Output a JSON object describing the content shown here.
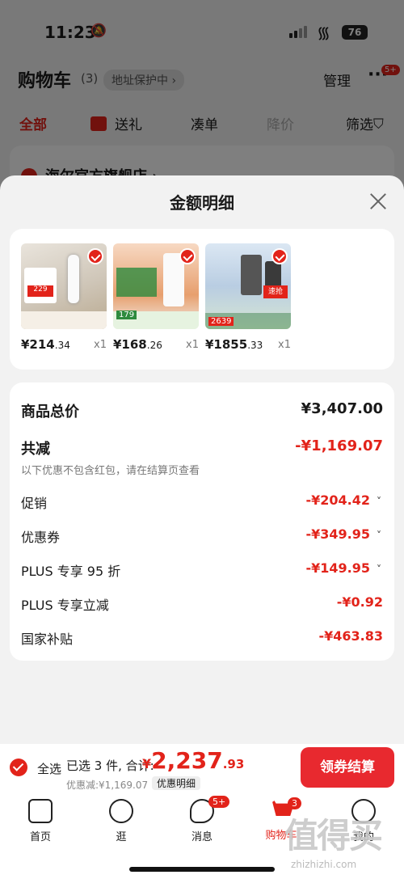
{
  "status_bar": {
    "time": "11:23",
    "battery": "76"
  },
  "header": {
    "title": "购物车",
    "count": "(3)",
    "address_protect": "地址保护中 ›",
    "manage": "管理",
    "more": "···",
    "more_badge": "5+"
  },
  "tabs": [
    "全部",
    "送礼",
    "凑单",
    "降价",
    "筛选"
  ],
  "store_name": "海尔官方旗舰店 ›",
  "sheet": {
    "title": "金额明细",
    "products": [
      {
        "price_main": "¥214",
        "price_dec": ".34",
        "qty": "x1"
      },
      {
        "price_main": "¥168",
        "price_dec": ".26",
        "qty": "x1"
      },
      {
        "price_main": "¥1855",
        "price_dec": ".33",
        "qty": "x1"
      }
    ],
    "product_images": {
      "p1_tag": "229",
      "p2_price": "179",
      "p3_hot": "速抢",
      "p3_price": "2639"
    },
    "total_label": "商品总价",
    "total_value": "¥3,407.00",
    "reduce_label": "共减",
    "reduce_value": "-¥1,169.07",
    "note": "以下优惠不包含红包，请在结算页查看",
    "items": [
      {
        "label": "促销",
        "value": "-¥204.42",
        "expand": "˅"
      },
      {
        "label": "优惠券",
        "value": "-¥349.95",
        "expand": "˅"
      },
      {
        "label": "PLUS 专享 95 折",
        "value": "-¥149.95",
        "expand": "˅"
      },
      {
        "label": "PLUS 专享立减",
        "value": "-¥0.92",
        "expand": ""
      },
      {
        "label": "国家补贴",
        "value": "-¥463.83",
        "expand": ""
      }
    ]
  },
  "bottom_bar": {
    "select_all": "全选",
    "selected": "已选 3 件, 合计:",
    "currency": "¥",
    "amount_main": "2,237",
    "amount_dec": ".93",
    "discount": "优惠减:¥1,169.07",
    "detail": "优惠明细",
    "checkout": "领券结算"
  },
  "tab_bar": [
    {
      "label": "首页",
      "badge": ""
    },
    {
      "label": "逛",
      "badge": ""
    },
    {
      "label": "消息",
      "badge": "5+"
    },
    {
      "label": "购物车",
      "badge": "3"
    },
    {
      "label": "我的",
      "badge": ""
    }
  ],
  "watermark": {
    "text": "值得买",
    "url": "zhizhizhi.com"
  },
  "colors": {
    "accent": "#e2231a",
    "overlay": "rgba(0,0,0,0.5)"
  }
}
